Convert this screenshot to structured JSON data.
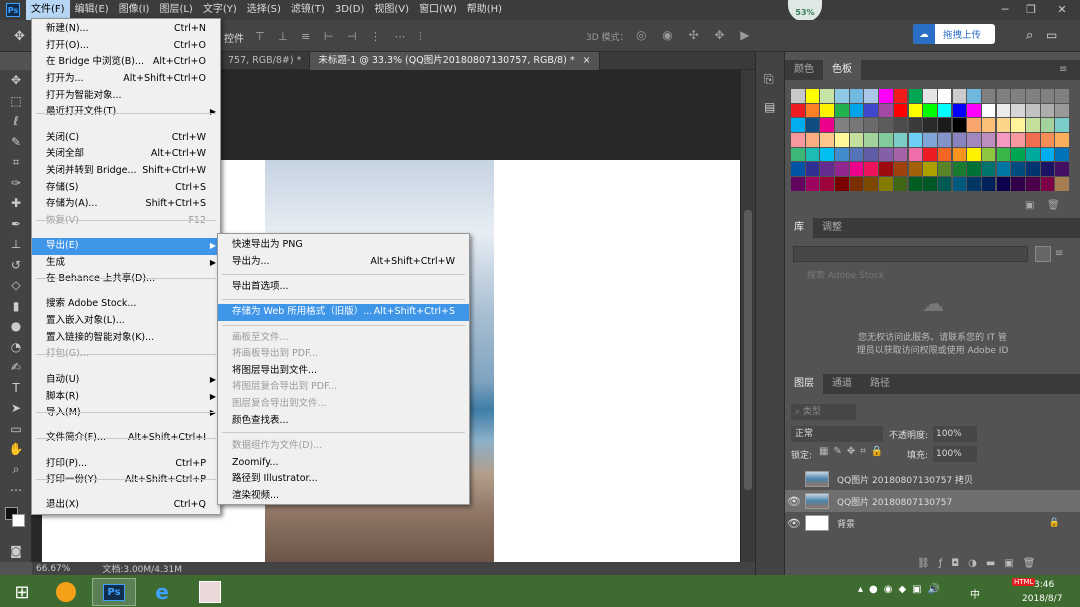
{
  "menubar": {
    "items": [
      "文件(F)",
      "编辑(E)",
      "图像(I)",
      "图层(L)",
      "文字(Y)",
      "选择(S)",
      "滤镜(T)",
      "3D(D)",
      "视图(V)",
      "窗口(W)",
      "帮助(H)"
    ],
    "app_icon": "Ps"
  },
  "options_bar": {
    "align_label": "控件",
    "mode3d": "3D 模式：",
    "cloud_label": "拖拽上传",
    "cpu": "53%"
  },
  "tabs": [
    "757, RGB/8#) *",
    "未标题-1 @ 33.3% (QQ图片20180807130757, RGB/8) *"
  ],
  "status": {
    "zoom": "66.67%",
    "doc": "文档:3.00M/4.31M"
  },
  "file_menu": [
    {
      "label": "新建(N)...",
      "shortcut": "Ctrl+N"
    },
    {
      "label": "打开(O)...",
      "shortcut": "Ctrl+O"
    },
    {
      "label": "在 Bridge 中浏览(B)...",
      "shortcut": "Alt+Ctrl+O"
    },
    {
      "label": "打开为...",
      "shortcut": "Alt+Shift+Ctrl+O"
    },
    {
      "label": "打开为智能对象...",
      "shortcut": ""
    },
    {
      "label": "最近打开文件(T)",
      "shortcut": ""
    },
    {
      "label": "关闭(C)",
      "shortcut": "Ctrl+W"
    },
    {
      "label": "关闭全部",
      "shortcut": "Alt+Ctrl+W"
    },
    {
      "label": "关闭并转到 Bridge...",
      "shortcut": "Shift+Ctrl+W"
    },
    {
      "label": "存储(S)",
      "shortcut": "Ctrl+S"
    },
    {
      "label": "存储为(A)...",
      "shortcut": "Shift+Ctrl+S"
    },
    {
      "label": "恢复(V)",
      "shortcut": "F12"
    },
    {
      "label": "导出(E)",
      "shortcut": ""
    },
    {
      "label": "生成",
      "shortcut": ""
    },
    {
      "label": "在 Behance 上共享(D)...",
      "shortcut": ""
    },
    {
      "label": "搜索 Adobe Stock...",
      "shortcut": ""
    },
    {
      "label": "置入嵌入对象(L)...",
      "shortcut": ""
    },
    {
      "label": "置入链接的智能对象(K)...",
      "shortcut": ""
    },
    {
      "label": "打包(G)...",
      "shortcut": ""
    },
    {
      "label": "自动(U)",
      "shortcut": ""
    },
    {
      "label": "脚本(R)",
      "shortcut": ""
    },
    {
      "label": "导入(M)",
      "shortcut": ""
    },
    {
      "label": "文件简介(F)...",
      "shortcut": "Alt+Shift+Ctrl+I"
    },
    {
      "label": "打印(P)...",
      "shortcut": "Ctrl+P"
    },
    {
      "label": "打印一份(Y)",
      "shortcut": "Alt+Shift+Ctrl+P"
    },
    {
      "label": "退出(X)",
      "shortcut": "Ctrl+Q"
    }
  ],
  "export_menu": [
    {
      "label": "快速导出为 PNG",
      "shortcut": ""
    },
    {
      "label": "导出为...",
      "shortcut": "Alt+Shift+Ctrl+W"
    },
    {
      "label": "导出首选项...",
      "shortcut": ""
    },
    {
      "label": "存储为 Web 所用格式（旧版）...",
      "shortcut": "Alt+Shift+Ctrl+S"
    },
    {
      "label": "画板至文件...",
      "shortcut": ""
    },
    {
      "label": "将画板导出到 PDF...",
      "shortcut": ""
    },
    {
      "label": "将图层导出到文件...",
      "shortcut": ""
    },
    {
      "label": "将图层复合导出到 PDF...",
      "shortcut": ""
    },
    {
      "label": "图层复合导出到文件...",
      "shortcut": ""
    },
    {
      "label": "颜色查找表...",
      "shortcut": ""
    },
    {
      "label": "数据组作为文件(D)...",
      "shortcut": ""
    },
    {
      "label": "Zoomify...",
      "shortcut": ""
    },
    {
      "label": "路径到 Illustrator...",
      "shortcut": ""
    },
    {
      "label": "渲染视频...",
      "shortcut": ""
    }
  ],
  "panels": {
    "color_tabs": [
      "颜色",
      "色板"
    ],
    "lib_tabs": [
      "库",
      "调整"
    ],
    "lib_search": "搜索 Adobe Stock",
    "lib_msg1": "您无权访问此服务。请联系您的 IT 管",
    "lib_msg2": "理员以获取访问权限或使用 Adobe ID",
    "layer_tabs": [
      "图层",
      "通道",
      "路径"
    ],
    "kind_filter": "类型",
    "blend_mode": "正常",
    "opacity_label": "不透明度:",
    "opacity_value": "100%",
    "lock_label": "锁定:",
    "fill_label": "填充:",
    "fill_value": "100%",
    "layers": [
      {
        "name": "QQ图片 20180807130757 拷贝",
        "visible": false,
        "selected": false
      },
      {
        "name": "QQ图片 20180807130757",
        "visible": true,
        "selected": true
      },
      {
        "name": "背景",
        "visible": true,
        "selected": false
      }
    ]
  },
  "tray": {
    "time": "3:46",
    "date": "2018/8/7",
    "ime": "中",
    "badge": "HTML"
  },
  "swatch_colors": [
    "#c8c8c8",
    "#ffff00",
    "#c9e5a5",
    "#8ecae6",
    "#6fb8e0",
    "#a9c6e8",
    "#ff00ff",
    "#f21b1b",
    "#00a651",
    "#e4e4e4",
    "#ffffff",
    "#cccccc",
    "#6fb8e0",
    "#808080",
    "#808080",
    "#808080",
    "#808080",
    "#808080",
    "#808080",
    "#ed1c24",
    "#ff7f27",
    "#fff200",
    "#22b14c",
    "#00a2e8",
    "#3f48cc",
    "#a349a4",
    "#fe0000",
    "#ffff00",
    "#00ff00",
    "#00ffff",
    "#0000ff",
    "#ff00ff",
    "#ffffff",
    "#ebebeb",
    "#d6d6d6",
    "#c2c2c2",
    "#adadad",
    "#999999",
    "#00aeef",
    "#0f4c81",
    "#ec008c",
    "#808080",
    "#777777",
    "#6b6b6b",
    "#5c5c5c",
    "#4c4c4c",
    "#3b3b3b",
    "#2b2b2b",
    "#1a1a1a",
    "#000000",
    "#f9a66c",
    "#fbbf77",
    "#fdd58a",
    "#fff39c",
    "#c4df9b",
    "#a3d39c",
    "#7accc8",
    "#f6989d",
    "#f9ad81",
    "#fdc68a",
    "#fff79a",
    "#c4df9b",
    "#a3d39c",
    "#82ca9c",
    "#7bcdc8",
    "#6ecff6",
    "#7ea7d8",
    "#8493ca",
    "#8882be",
    "#a187be",
    "#bc8dbf",
    "#f49ac2",
    "#f6989d",
    "#f26c4f",
    "#f68e55",
    "#fbaf5c",
    "#3cb878",
    "#1cbbb4",
    "#00bff3",
    "#438ccb",
    "#5574b9",
    "#605ca8",
    "#855fa8",
    "#a763a8",
    "#f06ea9",
    "#ed1c24",
    "#f26522",
    "#f7941d",
    "#fff200",
    "#8dc63f",
    "#39b54a",
    "#00a651",
    "#00a99d",
    "#00aeef",
    "#0072bc",
    "#0054a6",
    "#2e3192",
    "#662d91",
    "#92278f",
    "#ec008c",
    "#ed145b",
    "#9e0b0f",
    "#a0410d",
    "#a36209",
    "#aba000",
    "#598527",
    "#197b30",
    "#007236",
    "#00746b",
    "#0076a3",
    "#004b80",
    "#003471",
    "#1b1464",
    "#440e62",
    "#630460",
    "#9e005d",
    "#9e0039",
    "#790000",
    "#7b2e00",
    "#7d4900",
    "#827b00",
    "#406618",
    "#005e20",
    "#005826",
    "#005952",
    "#005b7f",
    "#003663",
    "#002157",
    "#0d004c",
    "#32004b",
    "#4b0049",
    "#7b0046",
    "#a67c52"
  ]
}
